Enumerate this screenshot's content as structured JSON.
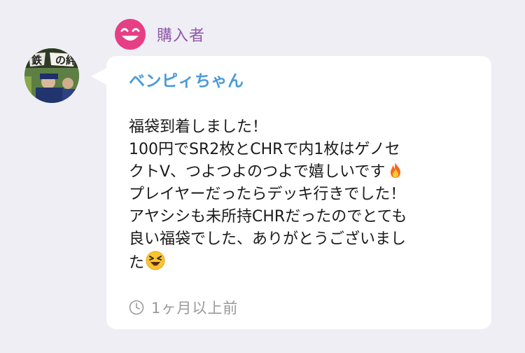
{
  "buyer_badge": {
    "label": "購入者",
    "icon": "smiling-face-icon",
    "color": "#e63f86"
  },
  "avatar": {
    "icon": "user-avatar-image"
  },
  "review": {
    "seller_name": "ベンピィちゃん",
    "message_lines": [
      "福袋到着しました！",
      "100円でSR2枚とCHRで内1枚はゲノセ",
      "クトV、つよつよのつよで嬉しいです",
      "プレイヤーだったらデッキ行きでした！",
      "アヤシシも未所持CHRだったのでとても",
      "良い福袋でした、ありがとうございまし",
      "た"
    ],
    "emoji_fire": "fire-emoji",
    "emoji_laugh": "laughing-face-emoji",
    "timestamp": "1ヶ月以上前",
    "timestamp_icon": "clock-icon"
  },
  "colors": {
    "background": "#efeef4",
    "buyer_label": "#8e59aa",
    "seller_name": "#4a9bd8",
    "timestamp": "#999999"
  }
}
